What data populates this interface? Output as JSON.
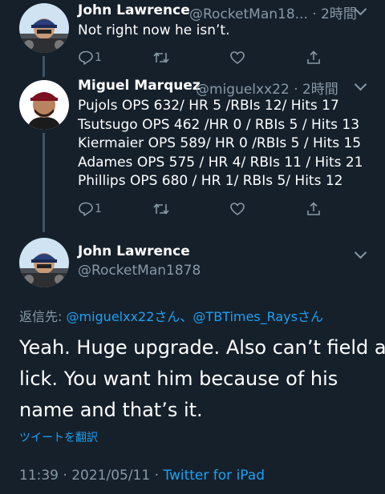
{
  "tweets": [
    {
      "name": "John Lawrence",
      "handle_time": "@RocketMan18... · 2時間",
      "lines": [
        "Not right now he isn’t."
      ],
      "reply_count": "1"
    },
    {
      "name": "Miguel Marquez",
      "handle_time": "@miguelxx22 · 2時間",
      "lines": [
        "Pujols OPS 632/ HR 5 /RBIs 12/ Hits 17",
        "Tsutsugo OPS 462 /HR 0 / RBIs 5 / Hits 13",
        "Kiermaier OPS 589/ HR 0 /RBIs 5 / Hits 15",
        "Adames OPS 575 / HR 4/ RBIs 11 / Hits 21",
        "Phillips OPS 680 / HR 1/ RBIs 5/ Hits 12"
      ],
      "reply_count": "1"
    }
  ],
  "main_tweet": {
    "name": "John Lawrence",
    "handle": "@RocketMan1878",
    "reply_to_prefix": "返信先: ",
    "reply_to_user1": "@miguelxx22さん",
    "reply_to_sep": "、",
    "reply_to_user2": "@TBTimes_Raysさん",
    "text_lines": [
      "Yeah. Huge upgrade. Also can’t field a",
      "lick. You want him because of his",
      "name and that’s it."
    ],
    "translate_label": "ツイートを翻訳",
    "meta_time": "11:39 · 2021/05/11 · ",
    "meta_source": "Twitter for iPad"
  },
  "colors": {
    "background": "#15202b",
    "secondary_text": "#8899a6",
    "link": "#1da1f2",
    "thread_line": "#3d5466"
  }
}
